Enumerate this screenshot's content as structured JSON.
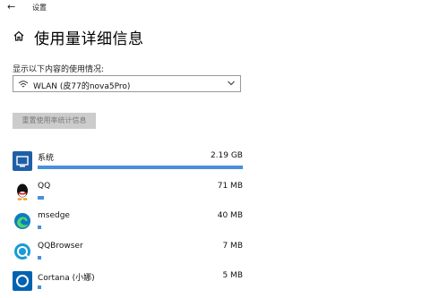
{
  "window": {
    "title": "设置",
    "back_glyph": "←"
  },
  "page": {
    "title": "使用量详细信息"
  },
  "filter": {
    "label": "显示以下内容的使用情况:",
    "selected": "WLAN (皮77的nova5Pro)"
  },
  "reset_button": {
    "label": "重置使用率统计信息"
  },
  "apps": [
    {
      "name": "系统",
      "size": "2.19 GB",
      "usage_fraction": 1.0,
      "icon": "system-icon",
      "color": "#1f5fa8"
    },
    {
      "name": "QQ",
      "size": "71 MB",
      "usage_fraction": 0.032,
      "icon": "qq-icon",
      "color": "#0f0f0f"
    },
    {
      "name": "msedge",
      "size": "40 MB",
      "usage_fraction": 0.018,
      "icon": "edge-icon",
      "color": "#0a7cc4"
    },
    {
      "name": "QQBrowser",
      "size": "7 MB",
      "usage_fraction": 0.004,
      "icon": "qqbrowser-icon",
      "color": "#1a9ad6"
    },
    {
      "name": "Cortana (小娜)",
      "size": "5 MB",
      "usage_fraction": 0.003,
      "icon": "cortana-icon",
      "color": "#0063b1"
    }
  ],
  "colors": {
    "accent": "#4a8fd9",
    "button_bg": "#cccccc"
  }
}
